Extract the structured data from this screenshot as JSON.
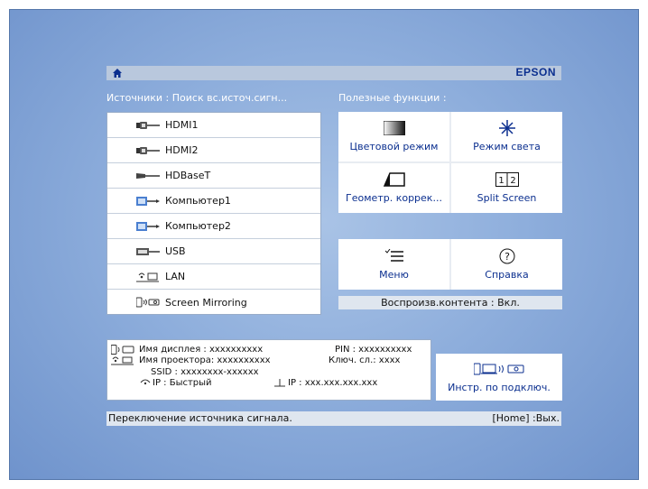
{
  "header": {
    "brand": "EPSON",
    "home_icon": "home-icon"
  },
  "sources": {
    "label": "Источники : Поиск вс.источ.сигн...",
    "items": [
      {
        "label": "HDMI1",
        "icon": "hdmi-icon"
      },
      {
        "label": "HDMI2",
        "icon": "hdmi-icon"
      },
      {
        "label": "HDBaseT",
        "icon": "hdbaset-icon"
      },
      {
        "label": "Компьютер1",
        "icon": "computer-icon"
      },
      {
        "label": "Компьютер2",
        "icon": "computer-icon"
      },
      {
        "label": "USB",
        "icon": "usb-icon"
      },
      {
        "label": "LAN",
        "icon": "lan-icon"
      },
      {
        "label": "Screen Mirroring",
        "icon": "screen-mirroring-icon"
      }
    ]
  },
  "functions": {
    "label": "Полезные функции :",
    "tiles": [
      {
        "label": "Цветовой режим",
        "icon": "color-mode-icon"
      },
      {
        "label": "Режим света",
        "icon": "light-mode-icon"
      },
      {
        "label": "Геометр. коррек...",
        "icon": "geometry-icon"
      },
      {
        "label": "Split Screen",
        "icon": "split-screen-icon",
        "icon_text_a": "1",
        "icon_text_b": "2"
      },
      {
        "label": "Меню",
        "icon": "menu-icon"
      },
      {
        "label": "Справка",
        "icon": "help-icon",
        "icon_text": "?"
      }
    ],
    "content_status": "Воспроизв.контента : Вкл."
  },
  "info": {
    "display_name": "Имя дисплея : xxxxxxxxxx",
    "projector_name": "Имя проектора: xxxxxxxxxx",
    "ssid": "SSID : xxxxxxxx-xxxxxx",
    "wifi_ip": "IP : Быстрый",
    "pin": "PIN : xxxxxxxxxx",
    "key": "Ключ. сл.: xxxx",
    "lan_ip": "IP : xxx.xxx.xxx.xxx"
  },
  "connection_button": {
    "label": "Инстр. по подключ.",
    "icon": "connection-devices-icon"
  },
  "footer": {
    "hint": "Переключение источника сигнала.",
    "exit": "[Home] :Вых."
  }
}
